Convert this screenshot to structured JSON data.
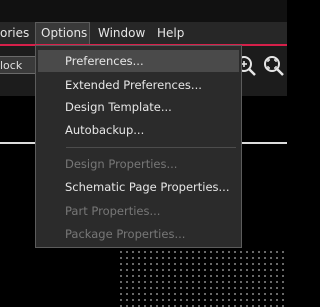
{
  "menubar": {
    "items": [
      "ories",
      "Options",
      "Window",
      "Help"
    ]
  },
  "toolbar": {
    "combo_value": "lock"
  },
  "options_menu": {
    "items": [
      {
        "label": "Preferences...",
        "enabled": true,
        "highlighted": true
      },
      {
        "label": "Extended Preferences...",
        "enabled": true
      },
      {
        "label": "Design Template...",
        "enabled": true
      },
      {
        "label": "Autobackup...",
        "enabled": true
      },
      {
        "label": "Design Properties...",
        "enabled": false
      },
      {
        "label": "Schematic Page Properties...",
        "enabled": true
      },
      {
        "label": "Part Properties...",
        "enabled": false
      },
      {
        "label": "Package Properties...",
        "enabled": false
      }
    ]
  },
  "colors": {
    "accent": "#d6204a",
    "menu_bg": "#2b2b2b",
    "menubar_bg": "#272727",
    "disabled_text": "#777777"
  },
  "icons": [
    "zoom-in-icon",
    "zoom-fit-icon"
  ]
}
